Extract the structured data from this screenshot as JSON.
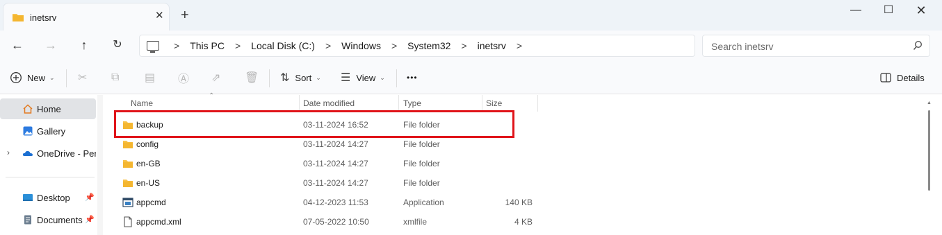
{
  "window": {
    "tab_title": "inetsrv",
    "new_tab": "+",
    "minimize": "—",
    "maximize": "☐",
    "close": "✕",
    "tab_close": "✕"
  },
  "nav": {
    "back": "←",
    "forward": "→",
    "up": "↑",
    "refresh": "↻"
  },
  "breadcrumb": [
    "This PC",
    "Local Disk (C:)",
    "Windows",
    "System32",
    "inetsrv"
  ],
  "breadcrumb_sep": ">",
  "search": {
    "placeholder": "Search inetsrv"
  },
  "toolbar": {
    "new_label": "New",
    "sort_label": "Sort",
    "view_label": "View",
    "more_label": "•••",
    "details_label": "Details"
  },
  "sidebar": {
    "items": [
      {
        "label": "Home",
        "icon": "home-icon",
        "selected": true
      },
      {
        "label": "Gallery",
        "icon": "gallery-icon"
      },
      {
        "label": "OneDrive - Personal",
        "icon": "onedrive-icon"
      },
      {
        "label": "Desktop",
        "icon": "desktop-icon",
        "pinned": true
      },
      {
        "label": "Documents",
        "icon": "documents-icon",
        "pinned": true
      }
    ]
  },
  "columns": {
    "name": "Name",
    "date": "Date modified",
    "type": "Type",
    "size": "Size"
  },
  "files": [
    {
      "name": "backup",
      "date": "03-11-2024 16:52",
      "type": "File folder",
      "size": "",
      "icon": "folder-icon",
      "highlighted": true
    },
    {
      "name": "config",
      "date": "03-11-2024 14:27",
      "type": "File folder",
      "size": "",
      "icon": "folder-icon"
    },
    {
      "name": "en-GB",
      "date": "03-11-2024 14:27",
      "type": "File folder",
      "size": "",
      "icon": "folder-icon"
    },
    {
      "name": "en-US",
      "date": "03-11-2024 14:27",
      "type": "File folder",
      "size": "",
      "icon": "folder-icon"
    },
    {
      "name": "appcmd",
      "date": "04-12-2023 11:53",
      "type": "Application",
      "size": "140 KB",
      "icon": "application-icon"
    },
    {
      "name": "appcmd.xml",
      "date": "07-05-2022 10:50",
      "type": "xmlfile",
      "size": "4 KB",
      "icon": "document-icon"
    }
  ],
  "colors": {
    "folder": "#f8c24a",
    "highlight_border": "#e0141a",
    "selected_sidebar": "#e1e3e6"
  }
}
